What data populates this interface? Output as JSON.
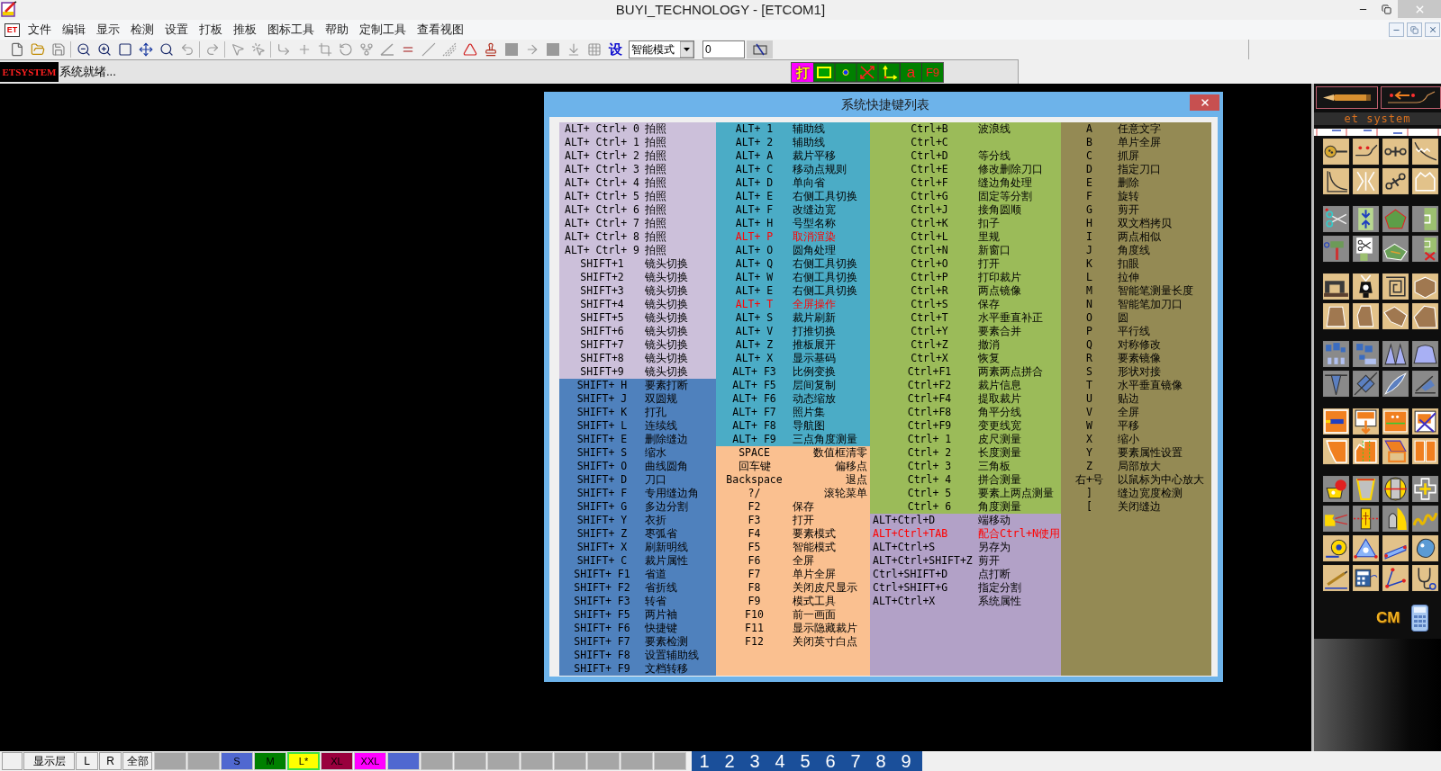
{
  "window": {
    "title": "BUYI_TECHNOLOGY - [ETCOM1]"
  },
  "menu_bar": {
    "document_badge": "ET",
    "items": [
      "文件",
      "编辑",
      "显示",
      "检测",
      "设置",
      "打板",
      "推板",
      "图标工具",
      "帮助",
      "定制工具",
      "查看视图"
    ]
  },
  "toolbar": {
    "settings_button": "设",
    "mode_select": "智能模式",
    "value_field": "0"
  },
  "status_bar": {
    "brand": "ETSYSTEM",
    "message": "系统就绪...",
    "plot_button": "打",
    "text_button": "a",
    "key_button": "F9"
  },
  "dialog": {
    "title": "系统快捷键列表",
    "columns": [
      {
        "groups": [
          {
            "color": "#ccc0da",
            "kind": "centered",
            "rows": [
              {
                "key": "ALT+ Ctrl+ 0",
                "action": "拍照",
                "highlighted": false
              },
              {
                "key": "ALT+ Ctrl+ 1",
                "action": "拍照",
                "highlighted": false
              },
              {
                "key": "ALT+ Ctrl+ 2",
                "action": "拍照",
                "highlighted": false
              },
              {
                "key": "ALT+ Ctrl+ 3",
                "action": "拍照",
                "highlighted": false
              },
              {
                "key": "ALT+ Ctrl+ 4",
                "action": "拍照",
                "highlighted": false
              },
              {
                "key": "ALT+ Ctrl+ 5",
                "action": "拍照",
                "highlighted": false
              },
              {
                "key": "ALT+ Ctrl+ 6",
                "action": "拍照",
                "highlighted": false
              },
              {
                "key": "ALT+ Ctrl+ 7",
                "action": "拍照",
                "highlighted": false
              },
              {
                "key": "ALT+ Ctrl+ 8",
                "action": "拍照",
                "highlighted": false
              },
              {
                "key": "ALT+ Ctrl+ 9",
                "action": "拍照",
                "highlighted": false
              },
              {
                "key": "SHIFT+1",
                "action": "镜头切换",
                "highlighted": false
              },
              {
                "key": "SHIFT+2",
                "action": "镜头切换",
                "highlighted": false
              },
              {
                "key": "SHIFT+3",
                "action": "镜头切换",
                "highlighted": false
              },
              {
                "key": "SHIFT+4",
                "action": "镜头切换",
                "highlighted": false
              },
              {
                "key": "SHIFT+5",
                "action": "镜头切换",
                "highlighted": false
              },
              {
                "key": "SHIFT+6",
                "action": "镜头切换",
                "highlighted": false
              },
              {
                "key": "SHIFT+7",
                "action": "镜头切换",
                "highlighted": false
              },
              {
                "key": "SHIFT+8",
                "action": "镜头切换",
                "highlighted": false
              },
              {
                "key": "SHIFT+9",
                "action": "镜头切换",
                "highlighted": false
              }
            ]
          },
          {
            "color": "#4f81bd",
            "kind": "centered",
            "rows": [
              {
                "key": "SHIFT+ H",
                "action": "要素打断",
                "highlighted": false
              },
              {
                "key": "SHIFT+ J",
                "action": "双圆规",
                "highlighted": false
              },
              {
                "key": "SHIFT+ K",
                "action": "打孔",
                "highlighted": false
              },
              {
                "key": "SHIFT+ L",
                "action": "连续线",
                "highlighted": false
              },
              {
                "key": "SHIFT+ E",
                "action": "删除缝边",
                "highlighted": false
              },
              {
                "key": "SHIFT+ S",
                "action": "缩水",
                "highlighted": false
              },
              {
                "key": "SHIFT+ O",
                "action": "曲线圆角",
                "highlighted": false
              },
              {
                "key": "SHIFT+ D",
                "action": "刀口",
                "highlighted": false
              },
              {
                "key": "SHIFT+ F",
                "action": "专用缝边角",
                "highlighted": false
              },
              {
                "key": "SHIFT+ G",
                "action": "多边分割",
                "highlighted": false
              },
              {
                "key": "SHIFT+ Y",
                "action": "衣折",
                "highlighted": false
              },
              {
                "key": "SHIFT+ Z",
                "action": "枣弧省",
                "highlighted": false
              },
              {
                "key": "SHIFT+ X",
                "action": "刷新明线",
                "highlighted": false
              },
              {
                "key": "SHIFT+ C",
                "action": "裁片属性",
                "highlighted": false
              },
              {
                "key": "SHIFT+ F1",
                "action": "省道",
                "highlighted": false
              },
              {
                "key": "SHIFT+ F2",
                "action": "省折线",
                "highlighted": false
              },
              {
                "key": "SHIFT+ F3",
                "action": "转省",
                "highlighted": false
              },
              {
                "key": "SHIFT+ F5",
                "action": "两片袖",
                "highlighted": false
              },
              {
                "key": "SHIFT+ F6",
                "action": "快捷键",
                "highlighted": false
              },
              {
                "key": "SHIFT+ F7",
                "action": "要素检测",
                "highlighted": false
              },
              {
                "key": "SHIFT+ F8",
                "action": "设置辅助线",
                "highlighted": false
              },
              {
                "key": "SHIFT+ F9",
                "action": "文档转移",
                "highlighted": false
              }
            ]
          }
        ]
      },
      {
        "groups": [
          {
            "color": "#4bacc6",
            "kind": "centered",
            "rows": [
              {
                "key": "ALT+ 1",
                "action": "辅助线",
                "highlighted": false
              },
              {
                "key": "ALT+ 2",
                "action": "辅助线",
                "highlighted": false
              },
              {
                "key": "ALT+ A",
                "action": "裁片平移",
                "highlighted": false
              },
              {
                "key": "ALT+ C",
                "action": "移动点规则",
                "highlighted": false
              },
              {
                "key": "ALT+ D",
                "action": "单向省",
                "highlighted": false
              },
              {
                "key": "ALT+ E",
                "action": "右侧工具切换",
                "highlighted": false
              },
              {
                "key": "ALT+ F",
                "action": "改缝边宽",
                "highlighted": false
              },
              {
                "key": "ALT+ H",
                "action": "号型名称",
                "highlighted": false
              },
              {
                "key": "ALT+ P",
                "action": "取消渲染",
                "highlighted": true
              },
              {
                "key": "ALT+ O",
                "action": "圆角处理",
                "highlighted": false
              },
              {
                "key": "ALT+ Q",
                "action": "右侧工具切换",
                "highlighted": false
              },
              {
                "key": "ALT+ W",
                "action": "右侧工具切换",
                "highlighted": false
              },
              {
                "key": "ALT+ E",
                "action": "右侧工具切换",
                "highlighted": false
              },
              {
                "key": "ALT+ T",
                "action": "全屏操作",
                "highlighted": true
              },
              {
                "key": "ALT+ S",
                "action": "裁片刷新",
                "highlighted": false
              },
              {
                "key": "ALT+ V",
                "action": "打推切换",
                "highlighted": false
              },
              {
                "key": "ALT+ Z",
                "action": "推板展开",
                "highlighted": false
              },
              {
                "key": "ALT+ X",
                "action": "显示基码",
                "highlighted": false
              },
              {
                "key": "ALT+ F3",
                "action": "比例变换",
                "highlighted": false
              },
              {
                "key": "ALT+ F5",
                "action": "层间复制",
                "highlighted": false
              },
              {
                "key": "ALT+ F6",
                "action": "动态缩放",
                "highlighted": false
              },
              {
                "key": "ALT+ F7",
                "action": "照片集",
                "highlighted": false
              },
              {
                "key": "ALT+ F8",
                "action": "导航图",
                "highlighted": false
              },
              {
                "key": "ALT+ F9",
                "action": "三点角度测量",
                "highlighted": false
              }
            ]
          },
          {
            "color": "#fac090",
            "kind": "split",
            "rows": [
              {
                "key": "SPACE",
                "action": "数值框清零",
                "highlighted": false
              },
              {
                "key": "回车键",
                "action": "偏移点",
                "highlighted": false
              },
              {
                "key": "Backspace",
                "action": "退点",
                "highlighted": false
              },
              {
                "key": "?/",
                "action": "滚轮菜单",
                "highlighted": false
              }
            ]
          },
          {
            "color": "#fac090",
            "kind": "centered",
            "rows": [
              {
                "key": "F2",
                "action": "保存",
                "highlighted": false
              },
              {
                "key": "F3",
                "action": "打开",
                "highlighted": false
              },
              {
                "key": "F4",
                "action": "要素模式",
                "highlighted": false
              },
              {
                "key": "F5",
                "action": "智能模式",
                "highlighted": false
              },
              {
                "key": "F6",
                "action": "全屏",
                "highlighted": false
              },
              {
                "key": "F7",
                "action": "单片全屏",
                "highlighted": false
              },
              {
                "key": "F8",
                "action": "关闭皮尺显示",
                "highlighted": false
              },
              {
                "key": "F9",
                "action": "模式工具",
                "highlighted": false
              },
              {
                "key": "F10",
                "action": "前一画面",
                "highlighted": false
              },
              {
                "key": "F11",
                "action": "显示隐藏裁片",
                "highlighted": false
              },
              {
                "key": "F12",
                "action": "关闭英寸白点",
                "highlighted": false
              }
            ]
          }
        ]
      },
      {
        "groups": [
          {
            "color": "#9bbb59",
            "kind": "centered",
            "rows": [
              {
                "key": "Ctrl+B",
                "action": "波浪线",
                "highlighted": false
              },
              {
                "key": "Ctrl+C",
                "highlighted": false
              },
              {
                "key": "Ctrl+D",
                "action": "等分线",
                "highlighted": false
              },
              {
                "key": "Ctrl+E",
                "action": "修改删除刀口",
                "highlighted": false
              },
              {
                "key": "Ctrl+F",
                "action": "缝边角处理",
                "highlighted": false
              },
              {
                "key": "Ctrl+G",
                "action": "固定等分割",
                "highlighted": false
              },
              {
                "key": "Ctrl+J",
                "action": "接角圆顺",
                "highlighted": false
              },
              {
                "key": "Ctrl+K",
                "action": "扣子",
                "highlighted": false
              },
              {
                "key": "Ctrl+L",
                "action": "里规",
                "highlighted": false
              },
              {
                "key": "Ctrl+N",
                "action": "新窗口",
                "highlighted": false
              },
              {
                "key": "Ctrl+O",
                "action": "打开",
                "highlighted": false
              },
              {
                "key": "Ctrl+P",
                "action": "打印裁片",
                "highlighted": false
              },
              {
                "key": "Ctrl+R",
                "action": "两点镜像",
                "highlighted": false
              },
              {
                "key": "Ctrl+S",
                "action": "保存",
                "highlighted": false
              },
              {
                "key": "Ctrl+T",
                "action": "水平垂直补正",
                "highlighted": false
              },
              {
                "key": "Ctrl+Y",
                "action": "要素合并",
                "highlighted": false
              },
              {
                "key": "Ctrl+Z",
                "action": "撤消",
                "highlighted": false
              },
              {
                "key": "Ctrl+X",
                "action": "恢复",
                "highlighted": false
              },
              {
                "key": "Ctrl+F1",
                "action": "两素两点拼合",
                "highlighted": false
              },
              {
                "key": "Ctrl+F2",
                "action": "裁片信息",
                "highlighted": false
              },
              {
                "key": "Ctrl+F4",
                "action": "提取裁片",
                "highlighted": false
              },
              {
                "key": "Ctrl+F8",
                "action": "角平分线",
                "highlighted": false
              },
              {
                "key": "Ctrl+F9",
                "action": "变更线宽",
                "highlighted": false
              },
              {
                "key": "Ctrl+ 1",
                "action": "皮尺测量",
                "highlighted": false
              },
              {
                "key": "Ctrl+ 2",
                "action": "长度测量",
                "highlighted": false
              },
              {
                "key": "Ctrl+ 3",
                "action": "三角板",
                "highlighted": false
              },
              {
                "key": "Ctrl+ 4",
                "action": "拼合测量",
                "highlighted": false
              },
              {
                "key": "Ctrl+ 5",
                "action": "要素上两点测量",
                "highlighted": false
              },
              {
                "key": "Ctrl+ 6",
                "action": "角度测量",
                "highlighted": false
              }
            ]
          },
          {
            "color": "#b2a1c7",
            "kind": "flush",
            "rows": [
              {
                "key": "ALT+Ctrl+D",
                "action": "端移动",
                "highlighted": false
              },
              {
                "key": "ALT+Ctrl+TAB",
                "action": "配合Ctrl+N使用",
                "highlighted": true
              },
              {
                "key": "ALT+Ctrl+S",
                "action": "另存为",
                "highlighted": false
              },
              {
                "key": "ALT+Ctrl+SHIFT+Z",
                "action": "剪开",
                "highlighted": false
              },
              {
                "key": "Ctrl+SHIFT+D",
                "action": "点打断",
                "highlighted": false
              },
              {
                "key": "Ctrl+SHIFT+G",
                "action": "指定分割",
                "highlighted": false
              },
              {
                "key": "ALT+Ctrl+X",
                "action": "系统属性",
                "highlighted": false
              }
            ]
          }
        ]
      },
      {
        "groups": [
          {
            "color": "#948a54",
            "kind": "centered",
            "rows": [
              {
                "key": "A",
                "action": "任意文字",
                "highlighted": false
              },
              {
                "key": "B",
                "action": "单片全屏",
                "highlighted": false
              },
              {
                "key": "C",
                "action": "抓屏",
                "highlighted": false
              },
              {
                "key": "D",
                "action": "指定刀口",
                "highlighted": false
              },
              {
                "key": "E",
                "action": "删除",
                "highlighted": false
              },
              {
                "key": "F",
                "action": "旋转",
                "highlighted": false
              },
              {
                "key": "G",
                "action": "剪开",
                "highlighted": false
              },
              {
                "key": "H",
                "action": "双文档拷贝",
                "highlighted": false
              },
              {
                "key": "I",
                "action": "两点相似",
                "highlighted": false
              },
              {
                "key": "J",
                "action": "角度线",
                "highlighted": false
              },
              {
                "key": "K",
                "action": "扣眼",
                "highlighted": false
              },
              {
                "key": "L",
                "action": "拉伸",
                "highlighted": false
              },
              {
                "key": "M",
                "action": "智能笔测量长度",
                "highlighted": false
              },
              {
                "key": "N",
                "action": "智能笔加刀口",
                "highlighted": false
              },
              {
                "key": "O",
                "action": "圆",
                "highlighted": false
              },
              {
                "key": "P",
                "action": "平行线",
                "highlighted": false
              },
              {
                "key": "Q",
                "action": "对称修改",
                "highlighted": false
              },
              {
                "key": "R",
                "action": "要素镜像",
                "highlighted": false
              },
              {
                "key": "S",
                "action": "形状对接",
                "highlighted": false
              },
              {
                "key": "T",
                "action": "水平垂直镜像",
                "highlighted": false
              },
              {
                "key": "U",
                "action": "贴边",
                "highlighted": false
              },
              {
                "key": "V",
                "action": "全屏",
                "highlighted": false
              },
              {
                "key": "W",
                "action": "平移",
                "highlighted": false
              },
              {
                "key": "X",
                "action": "缩小",
                "highlighted": false
              },
              {
                "key": "Y",
                "action": "要素属性设置",
                "highlighted": false
              },
              {
                "key": "Z",
                "action": "局部放大",
                "highlighted": false
              },
              {
                "key": "右+号",
                "action": "以鼠标为中心放大",
                "highlighted": false
              },
              {
                "key": "]",
                "action": "缝边宽度检测",
                "highlighted": false
              },
              {
                "key": "[",
                "action": "关闭缝边",
                "highlighted": false
              }
            ]
          }
        ]
      }
    ]
  },
  "tool_panel": {
    "logo": "et system",
    "unit_button": "CM"
  },
  "bottom_bar": {
    "buttons": [
      "显示层",
      "L",
      "R",
      "全部"
    ],
    "sizes": [
      {
        "label": "S",
        "color": "#5068d0",
        "selected": false
      },
      {
        "label": "M",
        "color": "#008000",
        "selected": false
      },
      {
        "label": "L*",
        "color": "#ffff00",
        "selected": true
      },
      {
        "label": "XL",
        "color": "#99003d",
        "selected": false
      },
      {
        "label": "XXL",
        "color": "#ff00ff",
        "selected": false
      },
      {
        "color": "#5068d0",
        "selected": false
      }
    ],
    "layers": [
      "1",
      "2",
      "3",
      "4",
      "5",
      "6",
      "7",
      "8",
      "9"
    ]
  }
}
